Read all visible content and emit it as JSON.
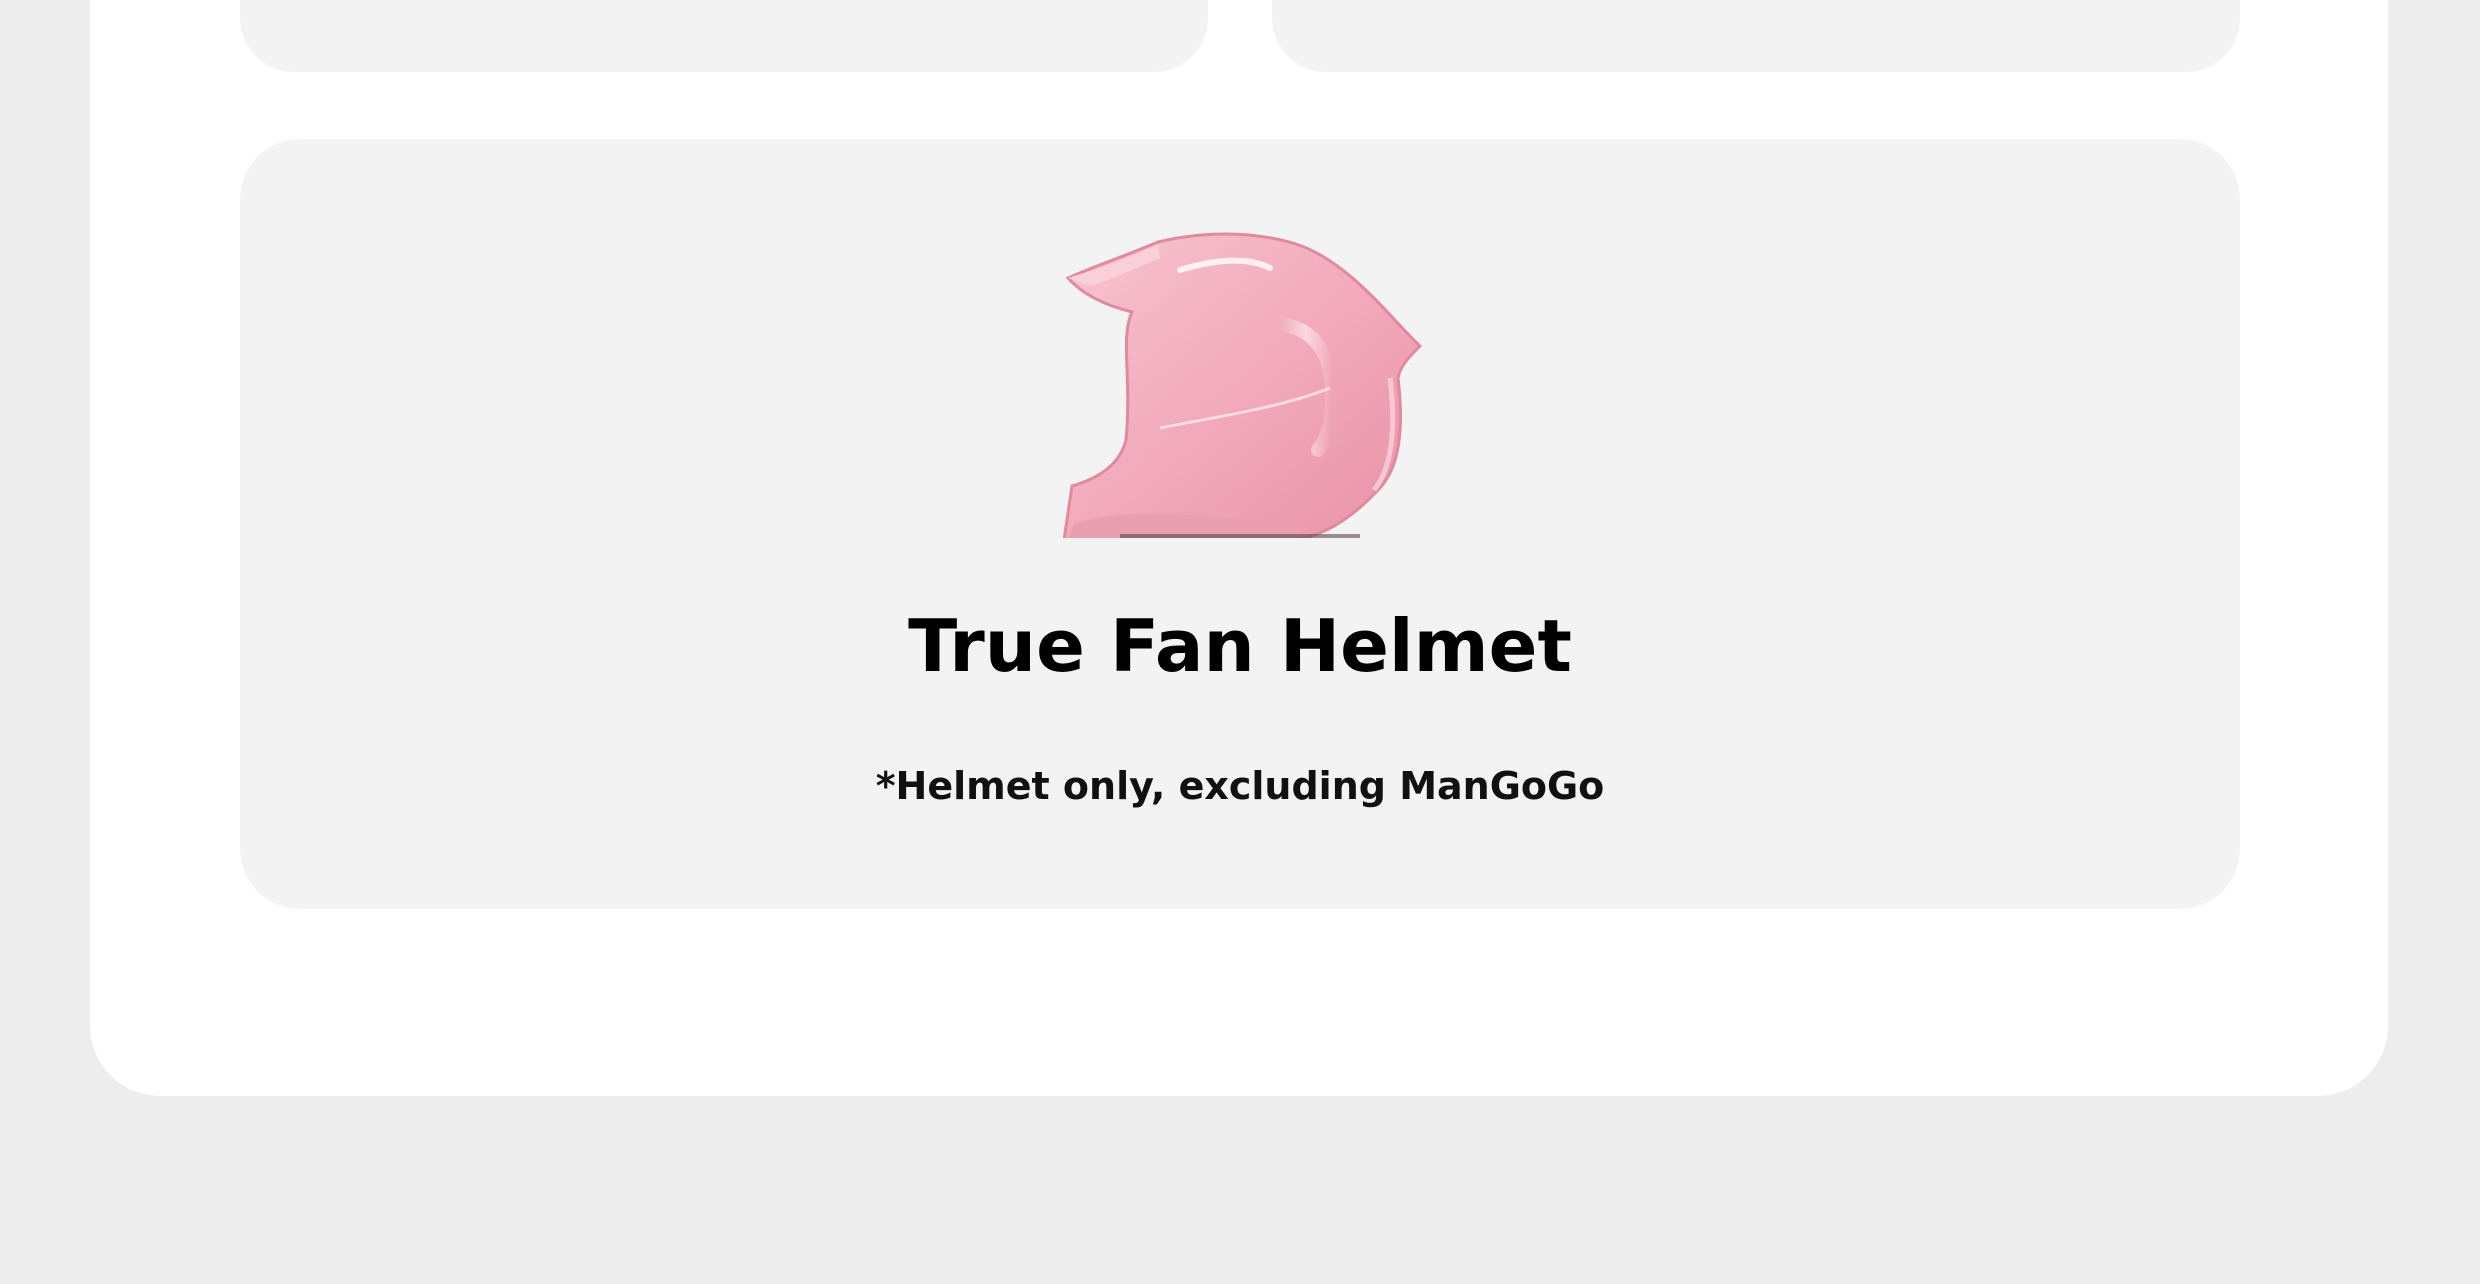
{
  "product": {
    "title": "True Fan Helmet",
    "note": "*Helmet only, excluding ManGoGo",
    "image_icon": "helmet-icon",
    "helmet_color": "#f4b3c2"
  },
  "colors": {
    "page_background": "#ededed",
    "card_background": "#ffffff",
    "panel_background": "#f3f3f3",
    "text": "#000000"
  }
}
